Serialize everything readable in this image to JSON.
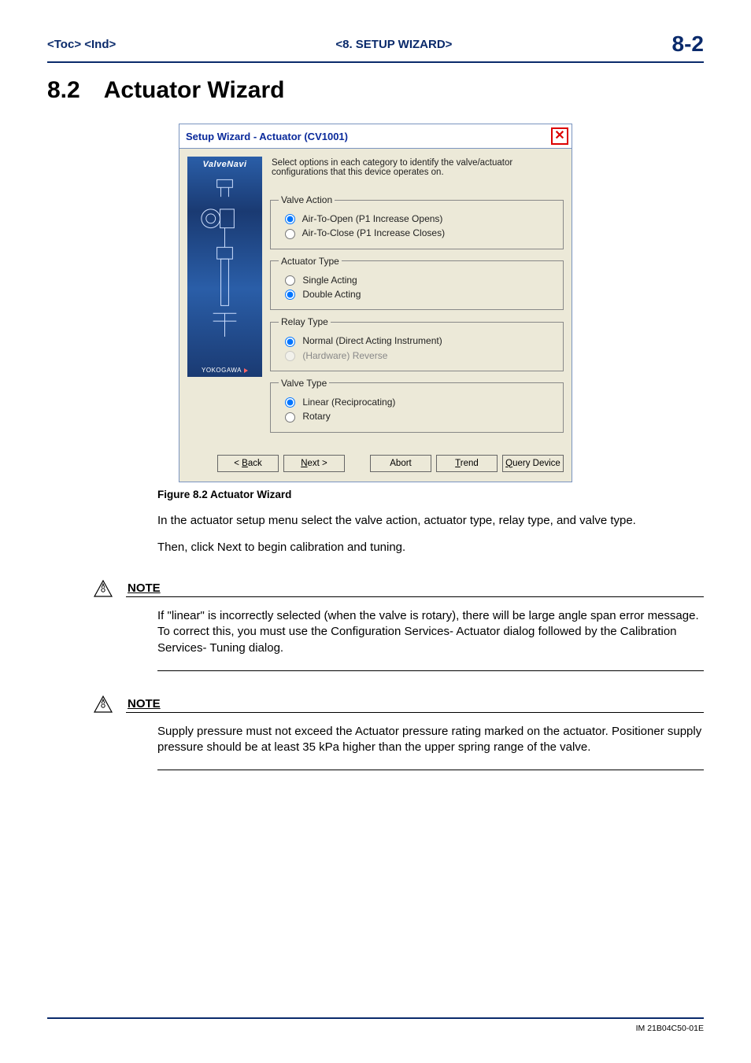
{
  "header": {
    "left": "<Toc>  <Ind>",
    "center": "<8.  SETUP WIZARD>",
    "page": "8-2"
  },
  "section": {
    "num": "8.2",
    "title": "Actuator Wizard"
  },
  "dialog": {
    "title": "Setup Wizard - Actuator (CV1001)",
    "instruction": "Select options in each category to identify the valve/actuator configurations that this device operates on.",
    "brand_top": "ValveNavi",
    "brand_bottom": "YOKOGAWA",
    "groups": {
      "valve_action": {
        "legend": "Valve Action",
        "opt1": "Air-To-Open (P1 Increase Opens)",
        "opt2": "Air-To-Close (P1 Increase Closes)"
      },
      "actuator_type": {
        "legend": "Actuator Type",
        "opt1": "Single Acting",
        "opt2": "Double Acting"
      },
      "relay_type": {
        "legend": "Relay Type",
        "opt1": "Normal (Direct Acting Instrument)",
        "opt2": "(Hardware) Reverse"
      },
      "valve_type": {
        "legend": "Valve Type",
        "opt1": "Linear (Reciprocating)",
        "opt2": "Rotary"
      }
    },
    "buttons": {
      "back": "< Back",
      "next": "Next >",
      "abort": "Abort",
      "trend": "Trend",
      "query": "Query Device"
    }
  },
  "caption": "Figure 8.2 Actuator Wizard",
  "para1": "In the actuator setup menu select the valve action, actuator type, relay type, and valve type.",
  "para2": "Then, click Next to begin calibration and tuning.",
  "notes": {
    "label": "NOTE",
    "n1": "If \"linear\" is incorrectly selected (when the valve is rotary), there will be large angle span error message.  To correct this, you must use the Configuration Services- Actuator dialog followed by the Calibration Services- Tuning dialog.",
    "n2": "Supply pressure must not exceed the Actuator pressure rating marked on the actuator. Positioner supply pressure should be at least 35 kPa higher than the upper spring range of the valve."
  },
  "footer": "IM 21B04C50-01E"
}
